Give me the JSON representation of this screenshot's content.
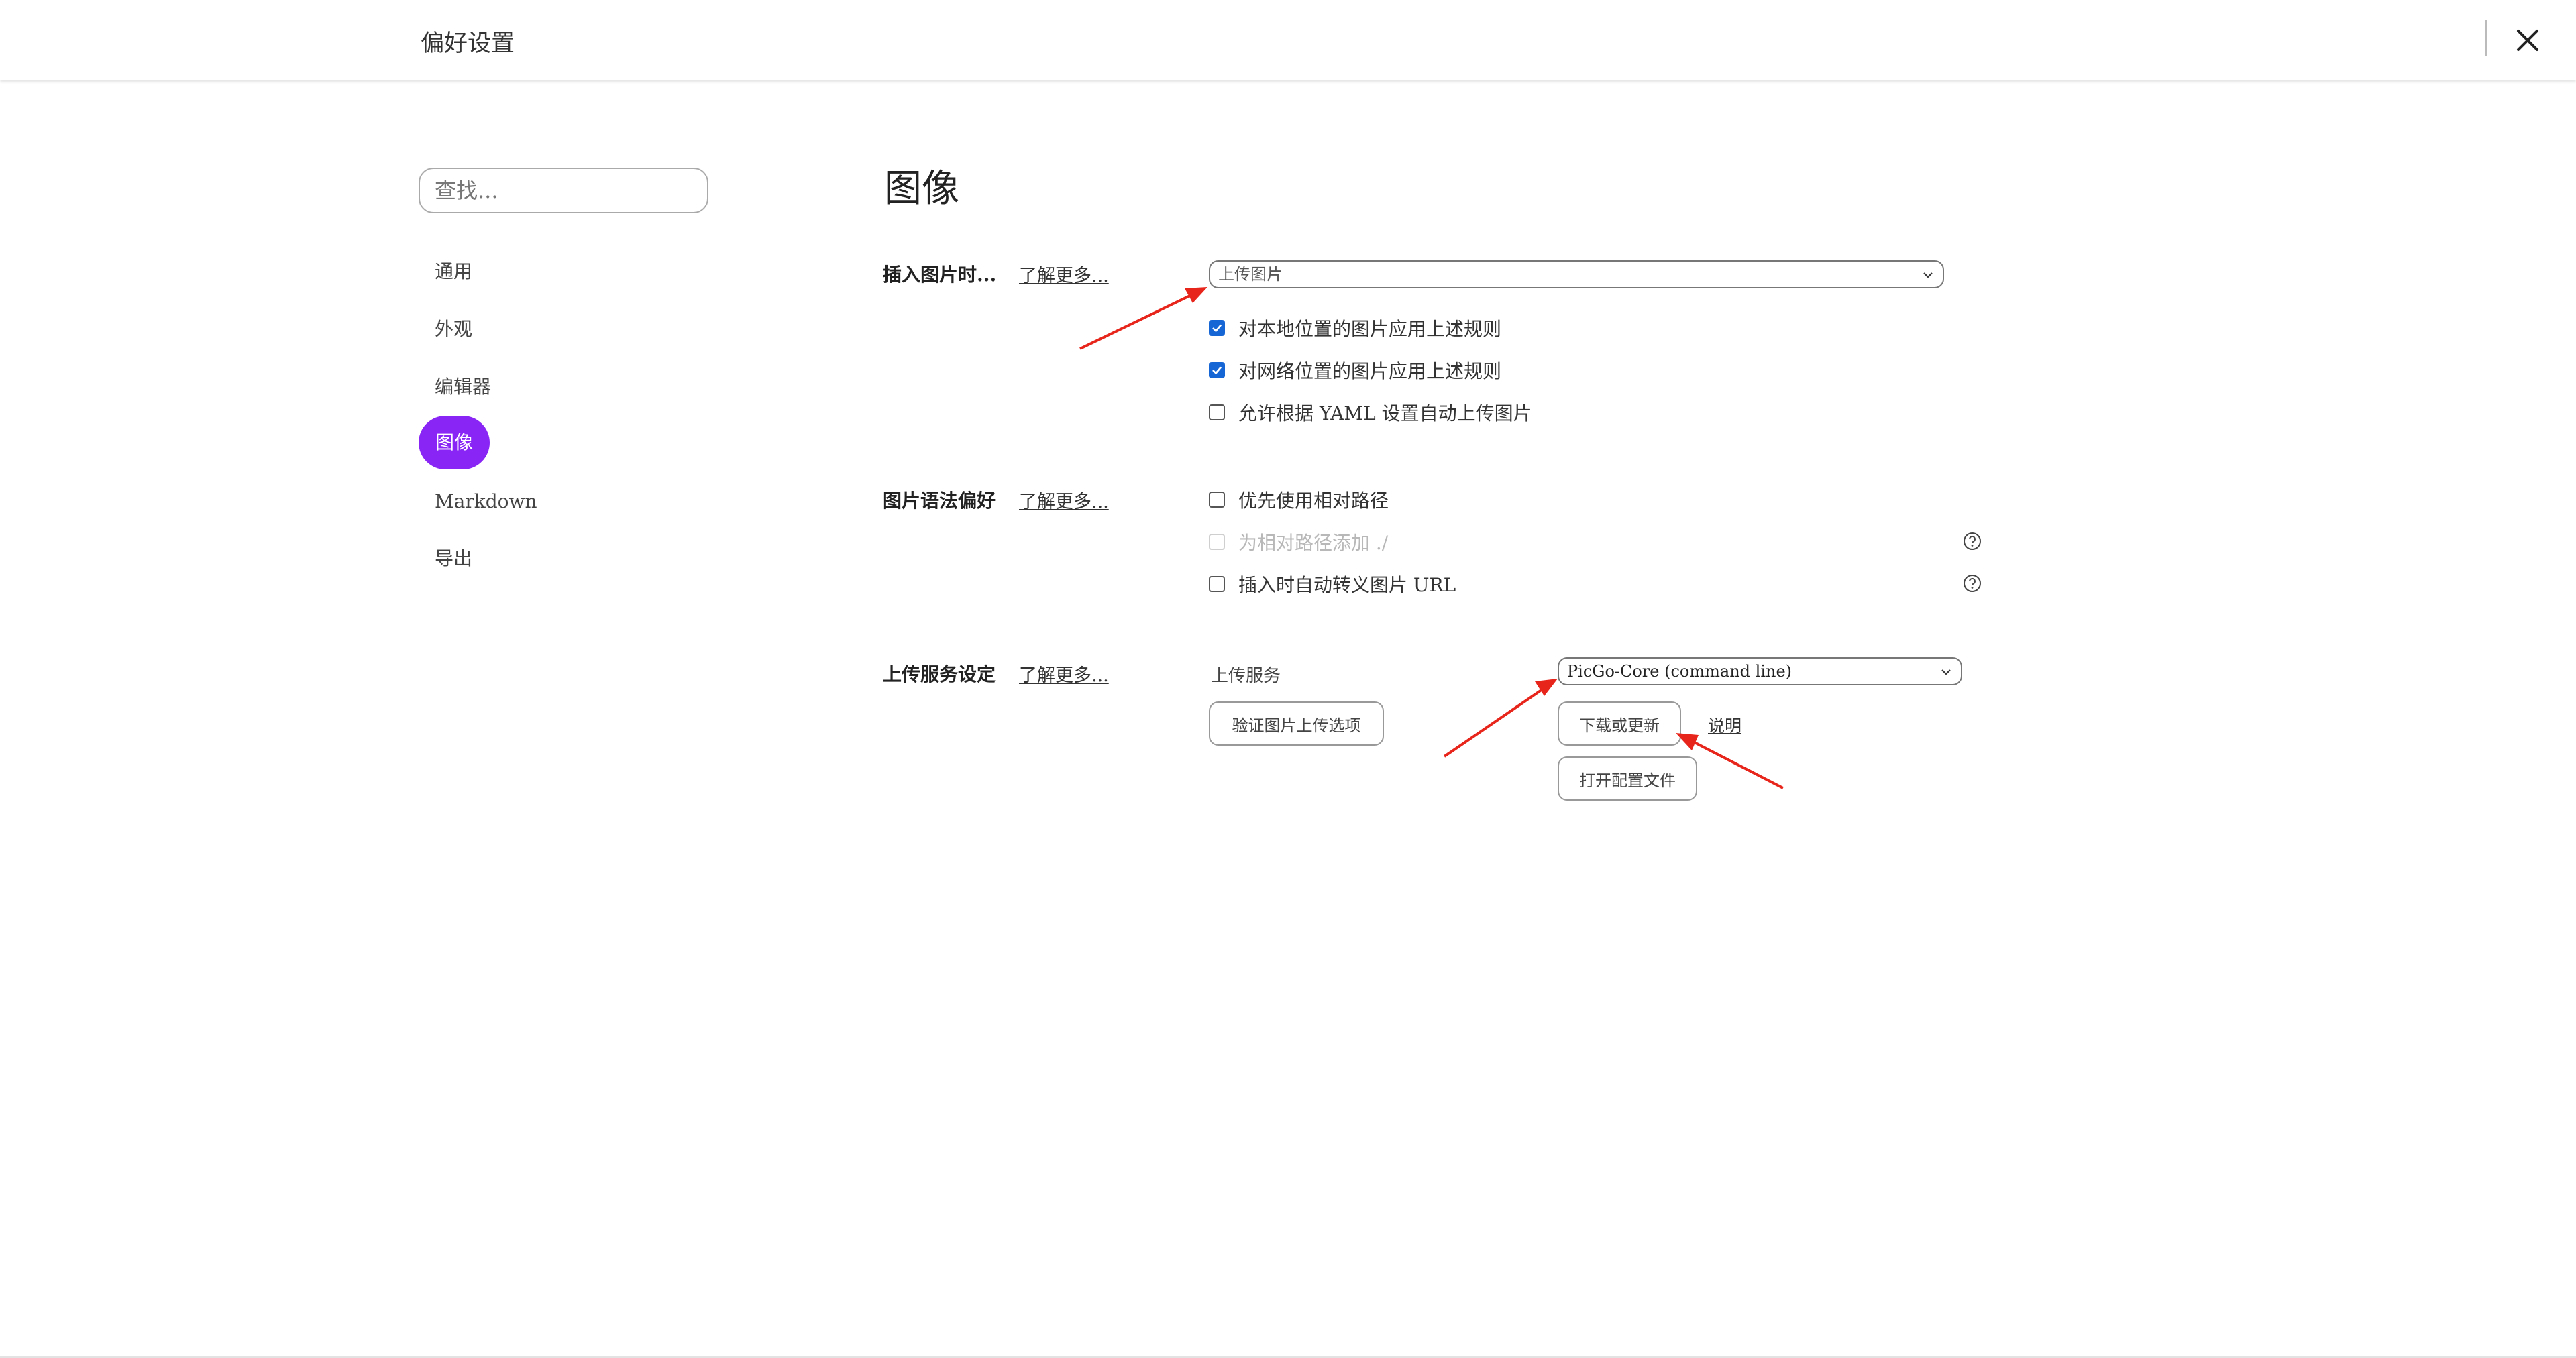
{
  "header": {
    "title": "偏好设置"
  },
  "sidebar": {
    "search_placeholder": "查找...",
    "items": [
      {
        "label": "通用",
        "active": false
      },
      {
        "label": "外观",
        "active": false
      },
      {
        "label": "编辑器",
        "active": false
      },
      {
        "label": "图像",
        "active": true
      },
      {
        "label": "Markdown",
        "active": false
      },
      {
        "label": "导出",
        "active": false
      }
    ]
  },
  "main": {
    "section_title": "图像",
    "insert": {
      "label": "插入图片时...",
      "learn_more": "了解更多...",
      "select_value": "上传图片",
      "options": [
        {
          "label": "对本地位置的图片应用上述规则",
          "checked": true,
          "disabled": false
        },
        {
          "label": "对网络位置的图片应用上述规则",
          "checked": true,
          "disabled": false
        },
        {
          "label": "允许根据 YAML 设置自动上传图片",
          "checked": false,
          "disabled": false
        }
      ]
    },
    "syntax": {
      "label": "图片语法偏好",
      "learn_more": "了解更多...",
      "options": [
        {
          "label": "优先使用相对路径",
          "checked": false,
          "disabled": false,
          "help": false
        },
        {
          "label": "为相对路径添加 ./",
          "checked": false,
          "disabled": true,
          "help": true
        },
        {
          "label": "插入时自动转义图片 URL",
          "checked": false,
          "disabled": false,
          "help": true
        }
      ]
    },
    "upload": {
      "label": "上传服务设定",
      "learn_more": "了解更多...",
      "service_label": "上传服务",
      "service_value": "PicGo-Core (command line)",
      "verify_button": "验证图片上传选项",
      "download_button": "下载或更新",
      "explain_link": "说明",
      "open_config_button": "打开配置文件"
    }
  },
  "colors": {
    "accent": "#8a26f5",
    "checkbox": "#1766d6",
    "annotation_arrow": "#e8251b"
  },
  "icons": {
    "close": "close-icon",
    "select_chevron": "chevron-down-icon",
    "help": "question-circle-icon",
    "check": "checkmark-icon"
  }
}
